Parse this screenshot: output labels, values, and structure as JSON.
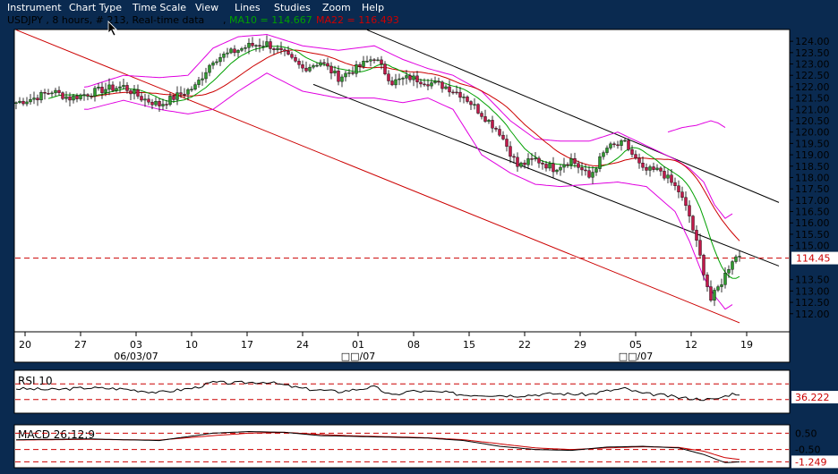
{
  "menu": [
    "Instrument",
    "Chart Type",
    "Time Scale",
    "View",
    "Lines",
    "Studies",
    "Zoom",
    "Help"
  ],
  "header": {
    "symbol_info": "USDJPY , 8 hours, # 213, Real-time data",
    "separator": ",",
    "ma10_text": "MA10 = 114.667",
    "ma22_text": "MA22 = 116.493"
  },
  "colors": {
    "background": "#0a2a50",
    "panel": "#ffffff",
    "up_candle": "#2e9a2e",
    "down_candle": "#c0184a",
    "ma10": "#00a000",
    "ma22": "#cc0000",
    "bollinger": "#e000e0",
    "channel": "#000000",
    "trendline": "#cc0000",
    "ref_line": "#cc0000"
  },
  "chart_data": [
    {
      "type": "candlestick",
      "series": [
        {
          "name": "USDJPY"
        },
        {
          "name": "MA10"
        },
        {
          "name": "MA22"
        }
      ],
      "ylim": [
        111.4,
        124.4
      ],
      "yticks": [
        "124.00",
        "123.50",
        "123.00",
        "122.50",
        "122.00",
        "121.50",
        "121.00",
        "120.50",
        "120.00",
        "119.50",
        "119.00",
        "118.50",
        "118.00",
        "117.50",
        "117.00",
        "116.50",
        "116.00",
        "115.50",
        "115.00",
        "113.50",
        "113.00",
        "112.50",
        "112.00"
      ],
      "xtick_labels": [
        "20",
        "27",
        "03",
        "10",
        "17",
        "24",
        "01",
        "08",
        "15",
        "22",
        "29",
        "05",
        "12",
        "19"
      ],
      "xsub_labels": [
        "06/03/07",
        "□□/07",
        "□□/07"
      ],
      "reference_line": {
        "value": 114.45,
        "label": "114.45"
      },
      "waypoints": [
        [
          0,
          121.3
        ],
        [
          5,
          121.5
        ],
        [
          10,
          121.8
        ],
        [
          15,
          121.5
        ],
        [
          20,
          121.7
        ],
        [
          25,
          121.9
        ],
        [
          30,
          122.0
        ],
        [
          35,
          121.5
        ],
        [
          40,
          121.2
        ],
        [
          45,
          121.6
        ],
        [
          50,
          122.0
        ],
        [
          55,
          123.2
        ],
        [
          60,
          123.5
        ],
        [
          65,
          123.8
        ],
        [
          70,
          123.9
        ],
        [
          75,
          123.4
        ],
        [
          80,
          122.8
        ],
        [
          85,
          123.1
        ],
        [
          90,
          122.4
        ],
        [
          95,
          122.8
        ],
        [
          100,
          123.3
        ],
        [
          105,
          122.2
        ],
        [
          110,
          122.4
        ],
        [
          115,
          122.2
        ],
        [
          120,
          122.0
        ],
        [
          125,
          121.6
        ],
        [
          130,
          120.8
        ],
        [
          135,
          120.0
        ],
        [
          140,
          118.5
        ],
        [
          145,
          118.8
        ],
        [
          150,
          118.4
        ],
        [
          155,
          118.8
        ],
        [
          160,
          118.0
        ],
        [
          165,
          119.3
        ],
        [
          170,
          119.5
        ],
        [
          175,
          118.3
        ],
        [
          180,
          118.3
        ],
        [
          185,
          117.4
        ],
        [
          188,
          116.3
        ],
        [
          191,
          114.5
        ],
        [
          194,
          112.6
        ],
        [
          197,
          113.4
        ],
        [
          200,
          114.4
        ],
        [
          202,
          114.6
        ]
      ],
      "bollinger_upper": [
        [
          10,
          121.8
        ],
        [
          20,
          122.0
        ],
        [
          30,
          122.5
        ],
        [
          40,
          122.4
        ],
        [
          48,
          122.5
        ],
        [
          55,
          123.7
        ],
        [
          62,
          124.2
        ],
        [
          70,
          124.3
        ],
        [
          80,
          123.8
        ],
        [
          90,
          123.6
        ],
        [
          100,
          123.8
        ],
        [
          108,
          123.2
        ],
        [
          115,
          122.8
        ],
        [
          122,
          122.5
        ],
        [
          130,
          121.8
        ],
        [
          138,
          120.5
        ],
        [
          145,
          119.7
        ],
        [
          152,
          119.6
        ],
        [
          160,
          119.6
        ],
        [
          168,
          120.0
        ],
        [
          176,
          119.4
        ],
        [
          184,
          118.8
        ],
        [
          188,
          118.4
        ],
        [
          192,
          117.8
        ],
        [
          195,
          116.8
        ],
        [
          198,
          116.2
        ],
        [
          200,
          116.4
        ]
      ],
      "bollinger_lower": [
        [
          10,
          121.1
        ],
        [
          20,
          121.0
        ],
        [
          30,
          121.4
        ],
        [
          40,
          121.0
        ],
        [
          48,
          120.8
        ],
        [
          55,
          121.0
        ],
        [
          62,
          121.8
        ],
        [
          70,
          122.6
        ],
        [
          80,
          121.8
        ],
        [
          90,
          121.5
        ],
        [
          100,
          121.5
        ],
        [
          108,
          121.3
        ],
        [
          115,
          121.5
        ],
        [
          122,
          121.0
        ],
        [
          130,
          119.0
        ],
        [
          138,
          118.2
        ],
        [
          145,
          117.7
        ],
        [
          152,
          117.6
        ],
        [
          160,
          117.7
        ],
        [
          168,
          117.8
        ],
        [
          176,
          117.6
        ],
        [
          184,
          116.5
        ],
        [
          188,
          115.2
        ],
        [
          192,
          113.6
        ],
        [
          195,
          112.8
        ],
        [
          198,
          112.2
        ],
        [
          200,
          112.4
        ]
      ],
      "far_right_band": [
        [
          182,
          120.0
        ],
        [
          186,
          120.2
        ],
        [
          190,
          120.3
        ],
        [
          194,
          120.5
        ],
        [
          196,
          120.4
        ],
        [
          198,
          120.2
        ]
      ],
      "ma22_text_value": 116.493,
      "ma10_text_value": 114.667,
      "channel_upper": [
        [
          98,
          124.5
        ],
        [
          213,
          116.9
        ]
      ],
      "channel_lower": [
        [
          83,
          122.1
        ],
        [
          213,
          114.1
        ]
      ],
      "trendline": [
        [
          0,
          124.5
        ],
        [
          202,
          111.6
        ]
      ]
    },
    {
      "type": "line",
      "series": [
        {
          "name": "RSI 10"
        }
      ],
      "ylim": [
        0,
        100
      ],
      "levels": [
        70,
        30
      ],
      "reference_value": 36.222,
      "reference_label": "36.222",
      "waypoints": [
        [
          0,
          58
        ],
        [
          10,
          55
        ],
        [
          20,
          60
        ],
        [
          30,
          57
        ],
        [
          40,
          48
        ],
        [
          50,
          60
        ],
        [
          55,
          74
        ],
        [
          60,
          72
        ],
        [
          70,
          75
        ],
        [
          80,
          58
        ],
        [
          90,
          50
        ],
        [
          100,
          62
        ],
        [
          105,
          40
        ],
        [
          110,
          52
        ],
        [
          120,
          48
        ],
        [
          125,
          42
        ],
        [
          130,
          42
        ],
        [
          140,
          40
        ],
        [
          150,
          45
        ],
        [
          160,
          43
        ],
        [
          165,
          52
        ],
        [
          170,
          58
        ],
        [
          175,
          45
        ],
        [
          180,
          42
        ],
        [
          185,
          35
        ],
        [
          190,
          32
        ],
        [
          195,
          30
        ],
        [
          200,
          45
        ]
      ]
    },
    {
      "type": "line",
      "series": [
        {
          "name": "MACD 26;12;9"
        }
      ],
      "ylim": [
        -1.5,
        0.9
      ],
      "levels": [
        0.5,
        -0.5,
        -1.249
      ],
      "reference_value": -1.249,
      "reference_label": "-1.249",
      "axis_labels": [
        "0.50",
        "-0.50"
      ],
      "waypoints": [
        [
          0,
          0.1
        ],
        [
          20,
          0.15
        ],
        [
          40,
          0.05
        ],
        [
          55,
          0.5
        ],
        [
          65,
          0.6
        ],
        [
          75,
          0.55
        ],
        [
          85,
          0.35
        ],
        [
          95,
          0.3
        ],
        [
          105,
          0.25
        ],
        [
          115,
          0.2
        ],
        [
          125,
          0.05
        ],
        [
          135,
          -0.3
        ],
        [
          145,
          -0.5
        ],
        [
          155,
          -0.55
        ],
        [
          165,
          -0.35
        ],
        [
          175,
          -0.3
        ],
        [
          185,
          -0.4
        ],
        [
          192,
          -0.8
        ],
        [
          198,
          -1.3
        ],
        [
          202,
          -1.25
        ]
      ],
      "signal_waypoints": [
        [
          0,
          0.08
        ],
        [
          20,
          0.12
        ],
        [
          40,
          0.08
        ],
        [
          55,
          0.35
        ],
        [
          65,
          0.5
        ],
        [
          75,
          0.55
        ],
        [
          85,
          0.42
        ],
        [
          95,
          0.33
        ],
        [
          105,
          0.28
        ],
        [
          115,
          0.22
        ],
        [
          125,
          0.1
        ],
        [
          135,
          -0.15
        ],
        [
          145,
          -0.4
        ],
        [
          155,
          -0.5
        ],
        [
          165,
          -0.4
        ],
        [
          175,
          -0.33
        ],
        [
          185,
          -0.37
        ],
        [
          192,
          -0.6
        ],
        [
          198,
          -1.0
        ],
        [
          202,
          -1.1
        ]
      ]
    }
  ]
}
